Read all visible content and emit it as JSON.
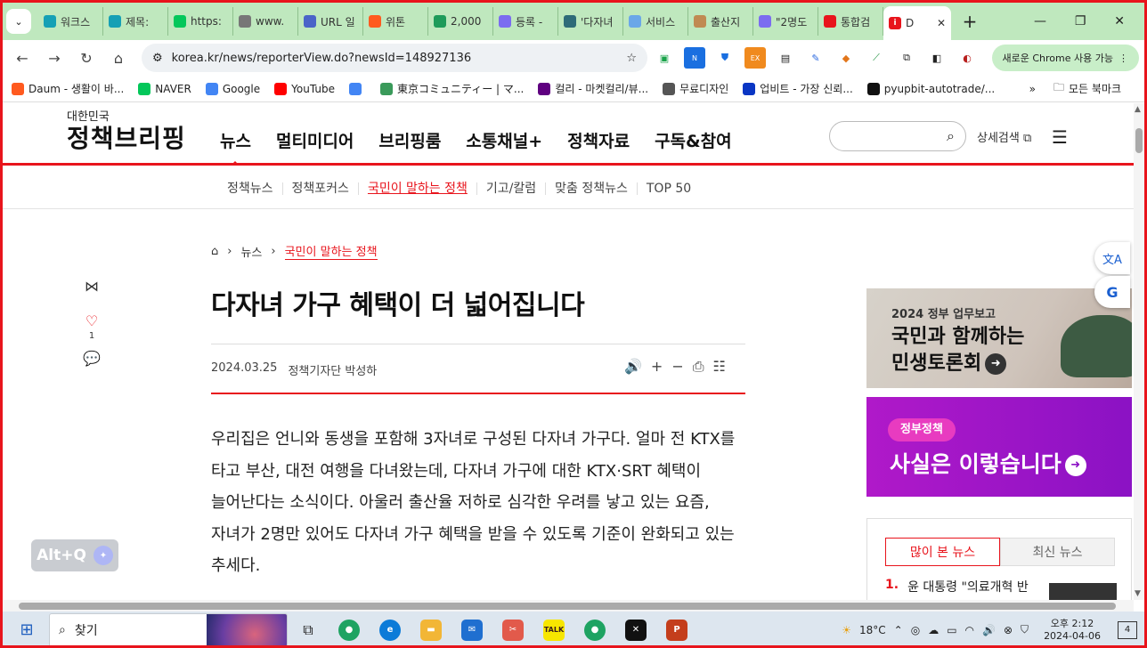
{
  "browser": {
    "tabs": [
      {
        "label": "워크스",
        "icon": "teal-circle-icon",
        "color": "#15a0b5"
      },
      {
        "label": "제목:",
        "icon": "teal-circle-icon",
        "color": "#15a0b5"
      },
      {
        "label": "https:",
        "icon": "naver-n-icon",
        "color": "#03c75a"
      },
      {
        "label": "www.",
        "icon": "globe-icon",
        "color": "#777777"
      },
      {
        "label": "URL 일",
        "icon": "url-icon",
        "color": "#4a64c8"
      },
      {
        "label": "위톤",
        "icon": "w-icon",
        "color": "#ff5a1f"
      },
      {
        "label": "2,000",
        "icon": "px-icon",
        "color": "#1e9b5a"
      },
      {
        "label": "등록 -",
        "icon": "d-icon",
        "color": "#7b6cf0"
      },
      {
        "label": "'다자녀",
        "icon": "news-icon",
        "color": "#2e6b78"
      },
      {
        "label": "서비스",
        "icon": "service-icon",
        "color": "#6aa7e8"
      },
      {
        "label": "출산지",
        "icon": "link-icon",
        "color": "#c08a52"
      },
      {
        "label": "\"2명도",
        "icon": "d-icon",
        "color": "#7b6cf0"
      },
      {
        "label": "통합검",
        "icon": "korea-icon",
        "color": "#e8141c"
      }
    ],
    "active_tab": {
      "label": "D",
      "icon": "korea-icon",
      "color": "#e8141c"
    },
    "url": "korea.kr/news/reporterView.do?newsId=148927136",
    "chrome_update_label": "새로운 Chrome 사용 가능",
    "bookmarks": [
      {
        "label": "Daum - 생활이 바...",
        "icon": "daum-icon",
        "color": "#ff5a1f"
      },
      {
        "label": "NAVER",
        "icon": "naver-n-icon",
        "color": "#03c75a"
      },
      {
        "label": "Google",
        "icon": "google-g-icon",
        "color": "#4285f4"
      },
      {
        "label": "YouTube",
        "icon": "youtube-icon",
        "color": "#ff0000"
      },
      {
        "label": "",
        "icon": "google-g-icon",
        "color": "#4285f4"
      },
      {
        "label": "東京コミュニティー | マ...",
        "icon": "community-icon",
        "color": "#3a9a5a"
      },
      {
        "label": "컬리 - 마켓컬리/뷰...",
        "icon": "kurly-icon",
        "color": "#5f0080"
      },
      {
        "label": "무료디자인",
        "icon": "folder-icon",
        "color": "#555555"
      },
      {
        "label": "업비트 - 가장 신뢰...",
        "icon": "upbit-icon",
        "color": "#0a36c4"
      },
      {
        "label": "pyupbit-autotrade/...",
        "icon": "github-icon",
        "color": "#111111"
      }
    ],
    "all_bookmarks_label": "모든 북마크"
  },
  "site": {
    "logo_small": "대한민국",
    "logo_main": "정책브리핑",
    "gnb": [
      "뉴스",
      "멀티미디어",
      "브리핑룸",
      "소통채널+",
      "정책자료",
      "구독&참여"
    ],
    "gnb_active": "뉴스",
    "advanced_search": "상세검색",
    "subnav": [
      "정책뉴스",
      "정책포커스",
      "국민이 말하는 정책",
      "기고/칼럼",
      "맞춤 정책뉴스",
      "TOP 50"
    ],
    "subnav_active": "국민이 말하는 정책",
    "accent_color": "#e8141c"
  },
  "article": {
    "breadcrumb": [
      "뉴스",
      "국민이 말하는 정책"
    ],
    "title": "다자녀 가구 혜택이 더 넓어집니다",
    "date": "2024.03.25",
    "reporter": "정책기자단 박성하",
    "like_count": "1",
    "body": "우리집은 언니와 동생을 포함해 3자녀로 구성된 다자녀 가구다. 얼마 전 KTX를 타고 부산, 대전 여행을 다녀왔는데, 다자녀 가구에 대한 KTX·SRT 혜택이 늘어난다는 소식이다. 아울러 출산율 저하로 심각한 우려를 낳고 있는 요즘, 자녀가 2명만 있어도 다자녀 가구 혜택을 받을 수 있도록 기준이 완화되고 있는 추세다."
  },
  "sidebar": {
    "banner1_line1": "2024 정부 업무보고",
    "banner1_line2": "국민과 함께하는",
    "banner1_line3": "민생토론회",
    "banner2_pill": "정부정책",
    "banner2_text": "사실은 이렇습니다",
    "news_tabs": [
      "많이 본 뉴스",
      "최신 뉴스"
    ],
    "news_rank": "1.",
    "news_item": "윤 대통령 \"의료개혁 반"
  },
  "overlay": {
    "altq_label": "Alt+Q"
  },
  "taskbar": {
    "search_placeholder": "찾기",
    "weather": "18°C",
    "time": "오후 2:12",
    "date": "2024-04-06",
    "notification_count": "4"
  }
}
